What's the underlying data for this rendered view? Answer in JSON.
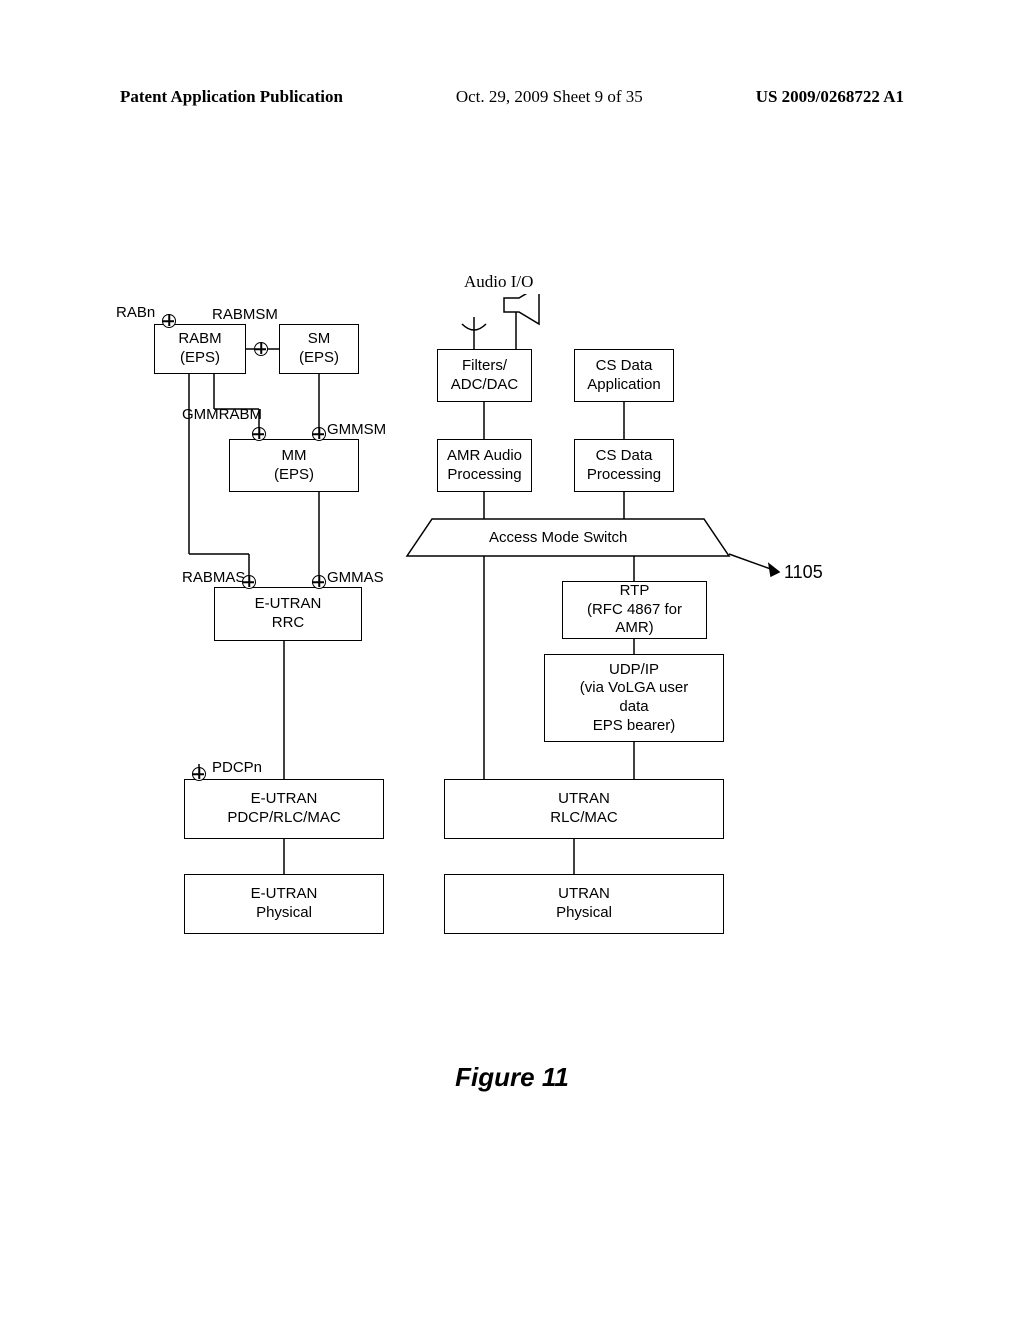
{
  "header": {
    "left": "Patent Application Publication",
    "mid": "Oct. 29, 2009  Sheet 9 of 35",
    "right": "US 2009/0268722 A1"
  },
  "figure_caption": "Figure 11",
  "callout_1105": "1105",
  "audio_io_label": "Audio I/O",
  "left_stack": {
    "rabm": "RABM\n(EPS)",
    "sm": "SM\n(EPS)",
    "mm": "MM\n(EPS)",
    "rrc": "E-UTRAN\nRRC",
    "pdcp": "E-UTRAN\nPDCP/RLC/MAC",
    "phy": "E-UTRAN\nPhysical"
  },
  "right_stack": {
    "filters": "Filters/\nADC/DAC",
    "csdata_app": "CS Data\nApplication",
    "amr": "AMR Audio\nProcessing",
    "csdata_proc": "CS Data\nProcessing",
    "switch": "Access Mode Switch",
    "rtp": "RTP\n(RFC 4867 for\nAMR)",
    "udpip": "UDP/IP\n(via VoLGA user\ndata\nEPS bearer)",
    "rlcmac": "UTRAN\nRLC/MAC",
    "phy": "UTRAN\nPhysical"
  },
  "sap_labels": {
    "rabn": "RABn",
    "rabmsm": "RABMSM",
    "gmmrabm": "GMMRABM",
    "gmmsm": "GMMSM",
    "rabmas": "RABMAS",
    "gmmas": "GMMAS",
    "pdcpn": "PDCPn"
  }
}
